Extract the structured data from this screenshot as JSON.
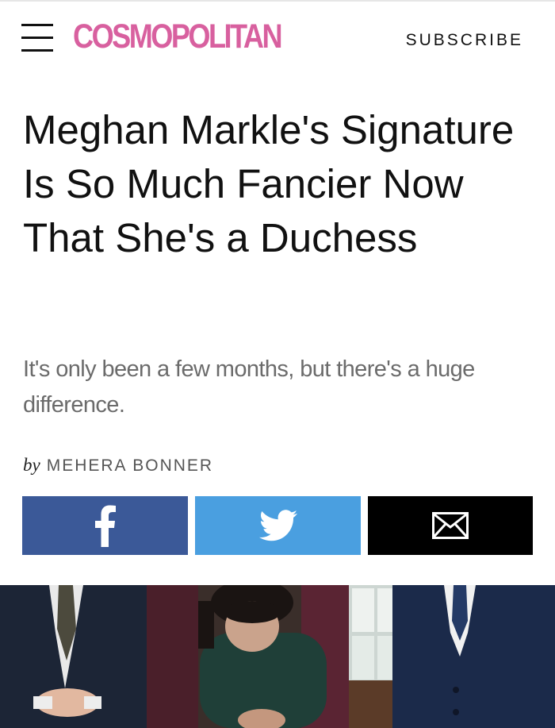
{
  "header": {
    "logo_text": "COSMOPOLITAN",
    "subscribe_label": "SUBSCRIBE",
    "brand_color": "#d8609f"
  },
  "article": {
    "headline": "Meghan Markle's Signature Is So Much Fancier Now That She's a Duchess",
    "dek": "It's only been a few months, but there's a huge difference.",
    "byline_prefix": "by",
    "author": "MEHERA BONNER"
  },
  "share": [
    {
      "network": "facebook",
      "icon": "facebook-icon",
      "color": "#3b5998"
    },
    {
      "network": "twitter",
      "icon": "twitter-icon",
      "color": "#4a9fe0"
    },
    {
      "network": "email",
      "icon": "email-icon",
      "color": "#000000"
    }
  ],
  "hero_image": {
    "description_icon": "photo"
  }
}
